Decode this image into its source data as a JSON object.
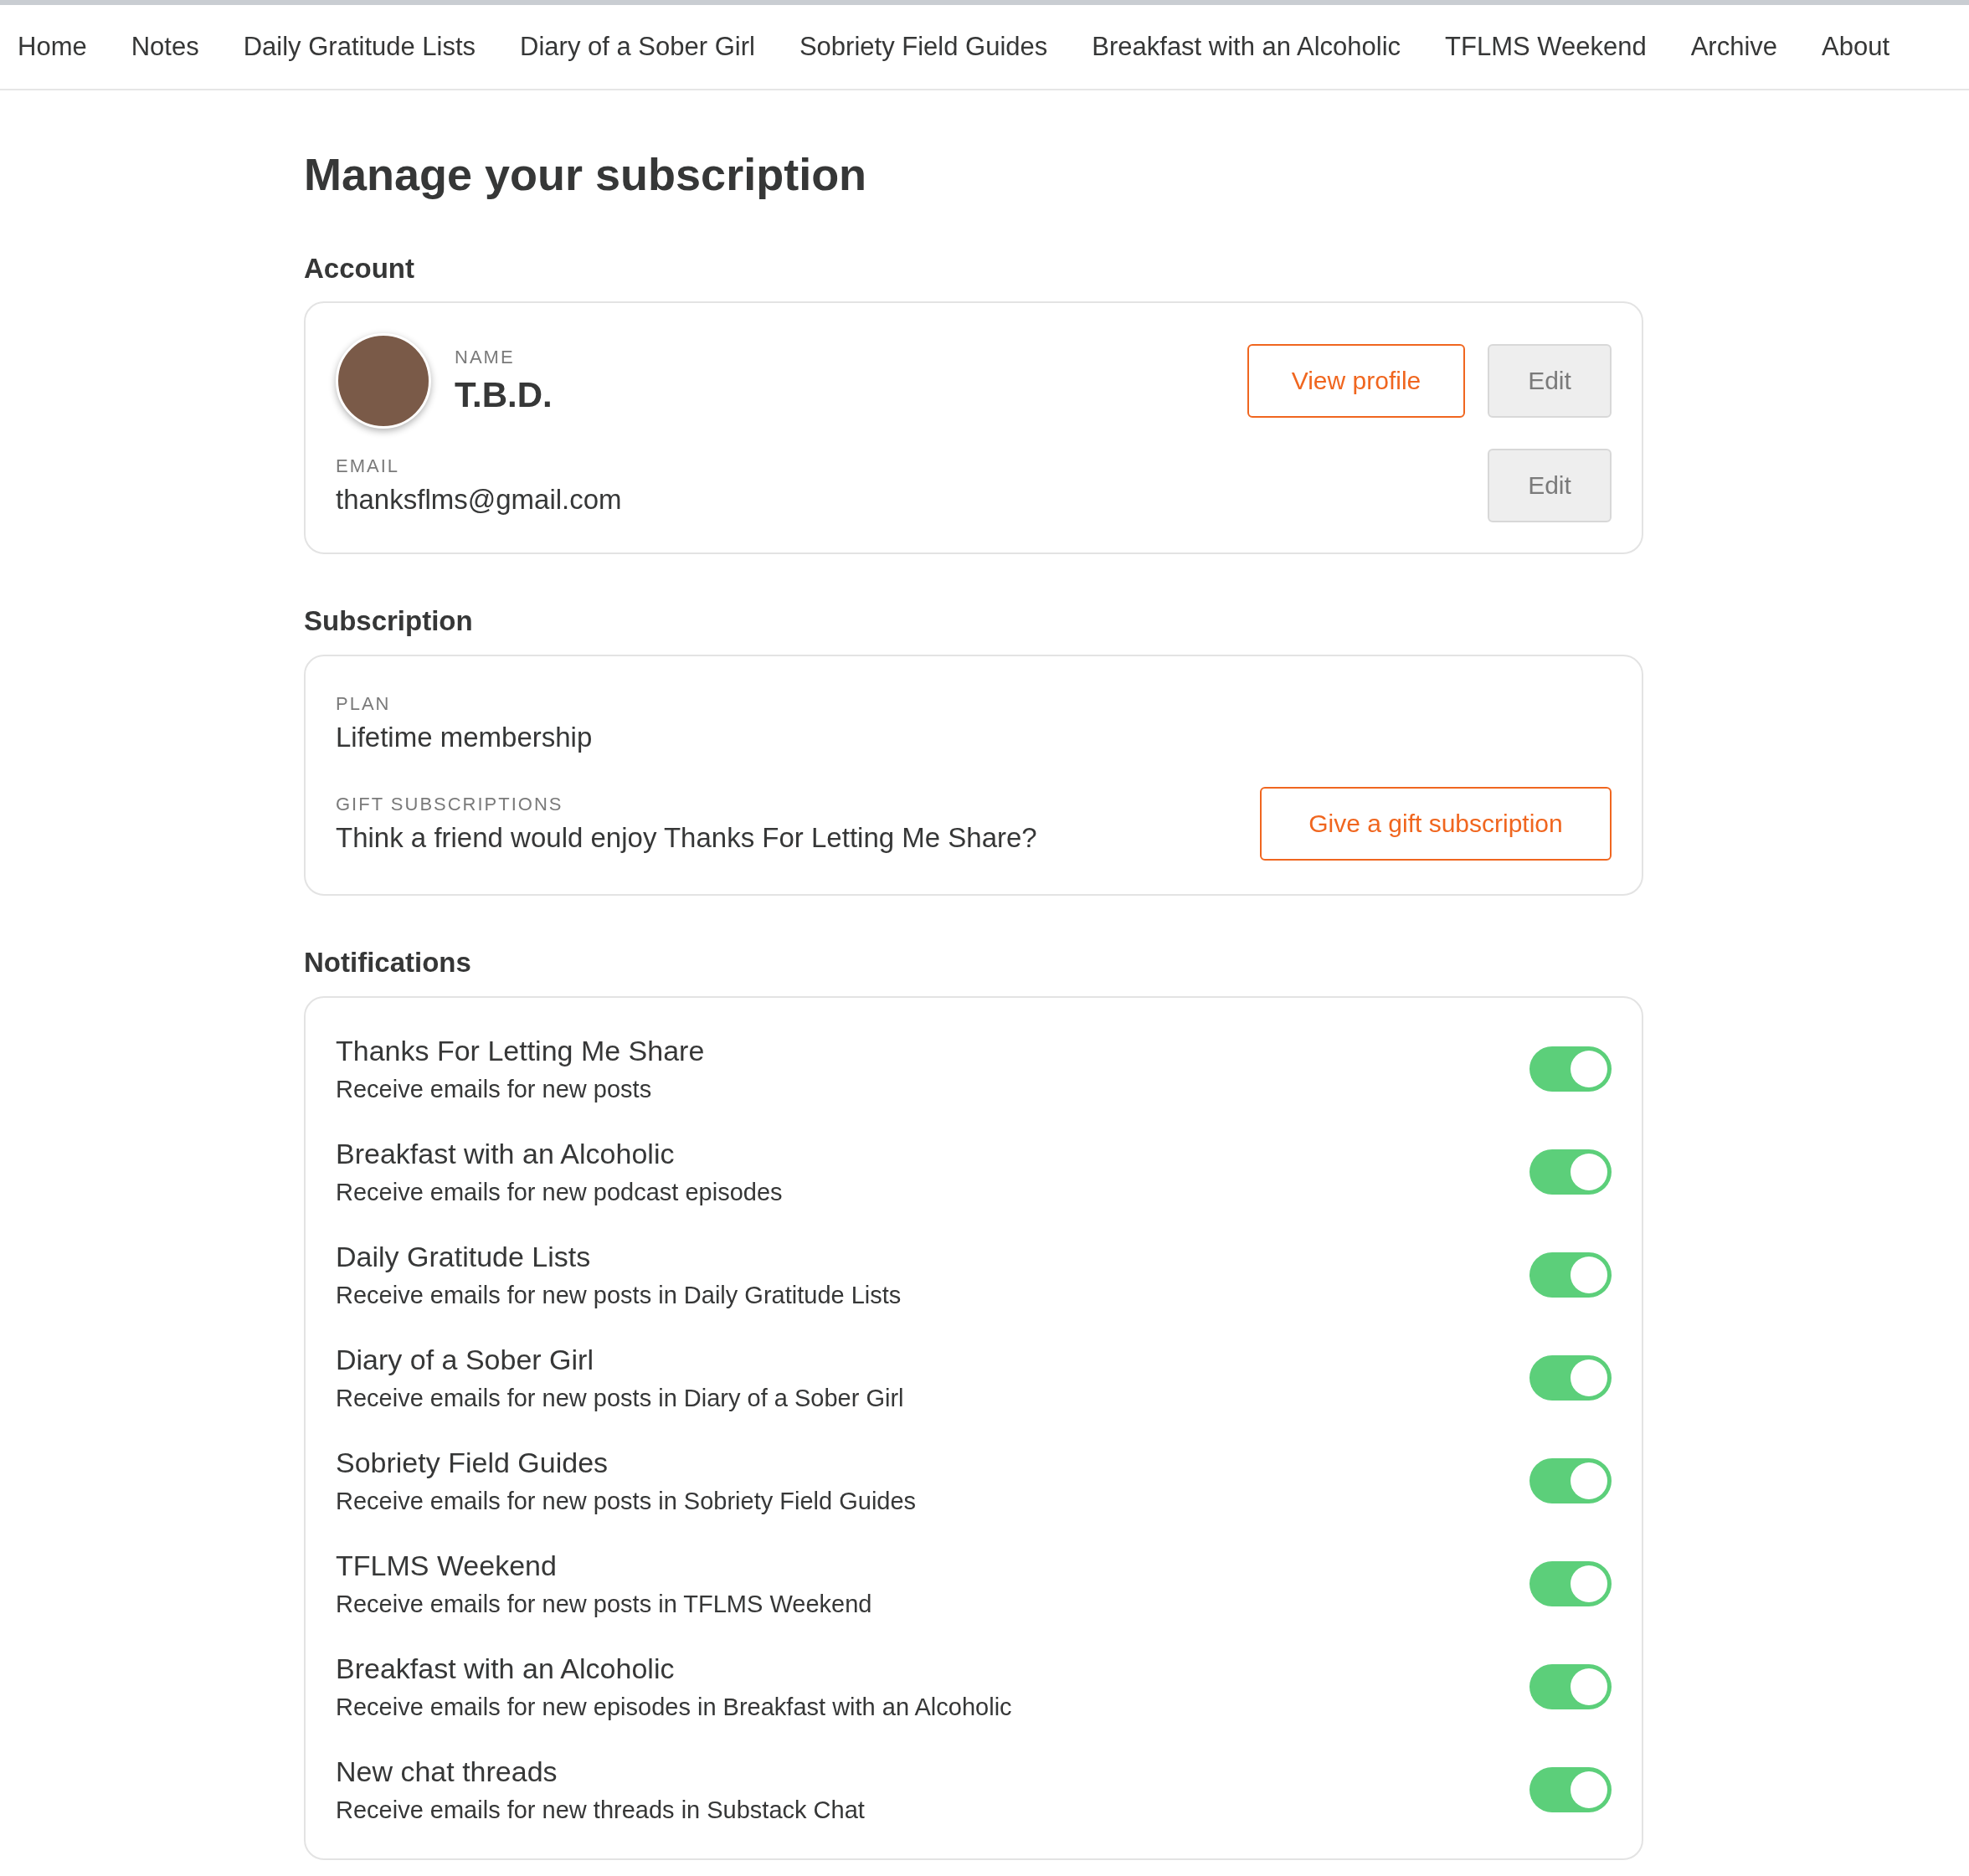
{
  "nav": [
    {
      "label": "Home"
    },
    {
      "label": "Notes"
    },
    {
      "label": "Daily Gratitude Lists"
    },
    {
      "label": "Diary of a Sober Girl"
    },
    {
      "label": "Sobriety Field Guides"
    },
    {
      "label": "Breakfast with an Alcoholic"
    },
    {
      "label": "TFLMS Weekend"
    },
    {
      "label": "Archive"
    },
    {
      "label": "About"
    }
  ],
  "title": "Manage your subscription",
  "account": {
    "heading": "Account",
    "name_label": "NAME",
    "name": "T.B.D.",
    "view_profile": "View profile",
    "edit": "Edit",
    "email_label": "EMAIL",
    "email": "thanksflms@gmail.com",
    "email_edit": "Edit"
  },
  "subscription": {
    "heading": "Subscription",
    "plan_label": "PLAN",
    "plan": "Lifetime membership",
    "gift_label": "GIFT SUBSCRIPTIONS",
    "gift_text": "Think a friend would enjoy Thanks For Letting Me Share?",
    "gift_button": "Give a gift subscription"
  },
  "notifications": {
    "heading": "Notifications",
    "items": [
      {
        "title": "Thanks For Letting Me Share",
        "subtitle": "Receive emails for new posts",
        "on": true
      },
      {
        "title": "Breakfast with an Alcoholic",
        "subtitle": "Receive emails for new podcast episodes",
        "on": true
      },
      {
        "title": "Daily Gratitude Lists",
        "subtitle": "Receive emails for new posts in Daily Gratitude Lists",
        "on": true
      },
      {
        "title": "Diary of a Sober Girl",
        "subtitle": "Receive emails for new posts in Diary of a Sober Girl",
        "on": true
      },
      {
        "title": "Sobriety Field Guides",
        "subtitle": "Receive emails for new posts in Sobriety Field Guides",
        "on": true
      },
      {
        "title": "TFLMS Weekend",
        "subtitle": "Receive emails for new posts in TFLMS Weekend",
        "on": true
      },
      {
        "title": "Breakfast with an Alcoholic",
        "subtitle": "Receive emails for new episodes in Breakfast with an Alcoholic",
        "on": true
      },
      {
        "title": "New chat threads",
        "subtitle": "Receive emails for new threads in Substack Chat",
        "on": true
      }
    ]
  }
}
